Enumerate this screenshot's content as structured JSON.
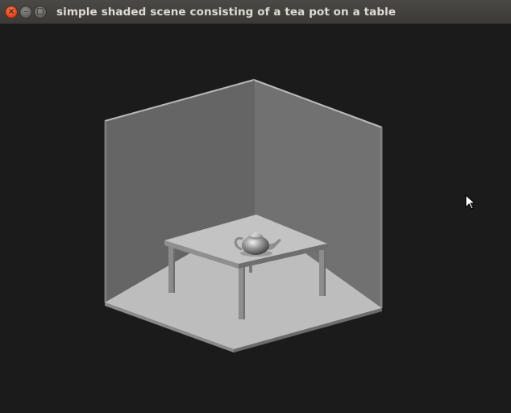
{
  "window": {
    "title": "simple shaded scene consisting of a tea pot on a table",
    "controls": {
      "close_glyph": "×",
      "minimize_glyph": "–",
      "maximize_glyph": "□"
    }
  },
  "colors": {
    "titlebar": "#3f3e3a",
    "background": "#1b1b1b",
    "wall_left": "#666666",
    "wall_right": "#727272",
    "floor": "#bdbdbd",
    "table_top": "#c2c2c2"
  },
  "icons": {
    "close": "close-icon",
    "minimize": "minimize-icon",
    "maximize": "maximize-icon",
    "cursor": "mouse-pointer-icon"
  }
}
